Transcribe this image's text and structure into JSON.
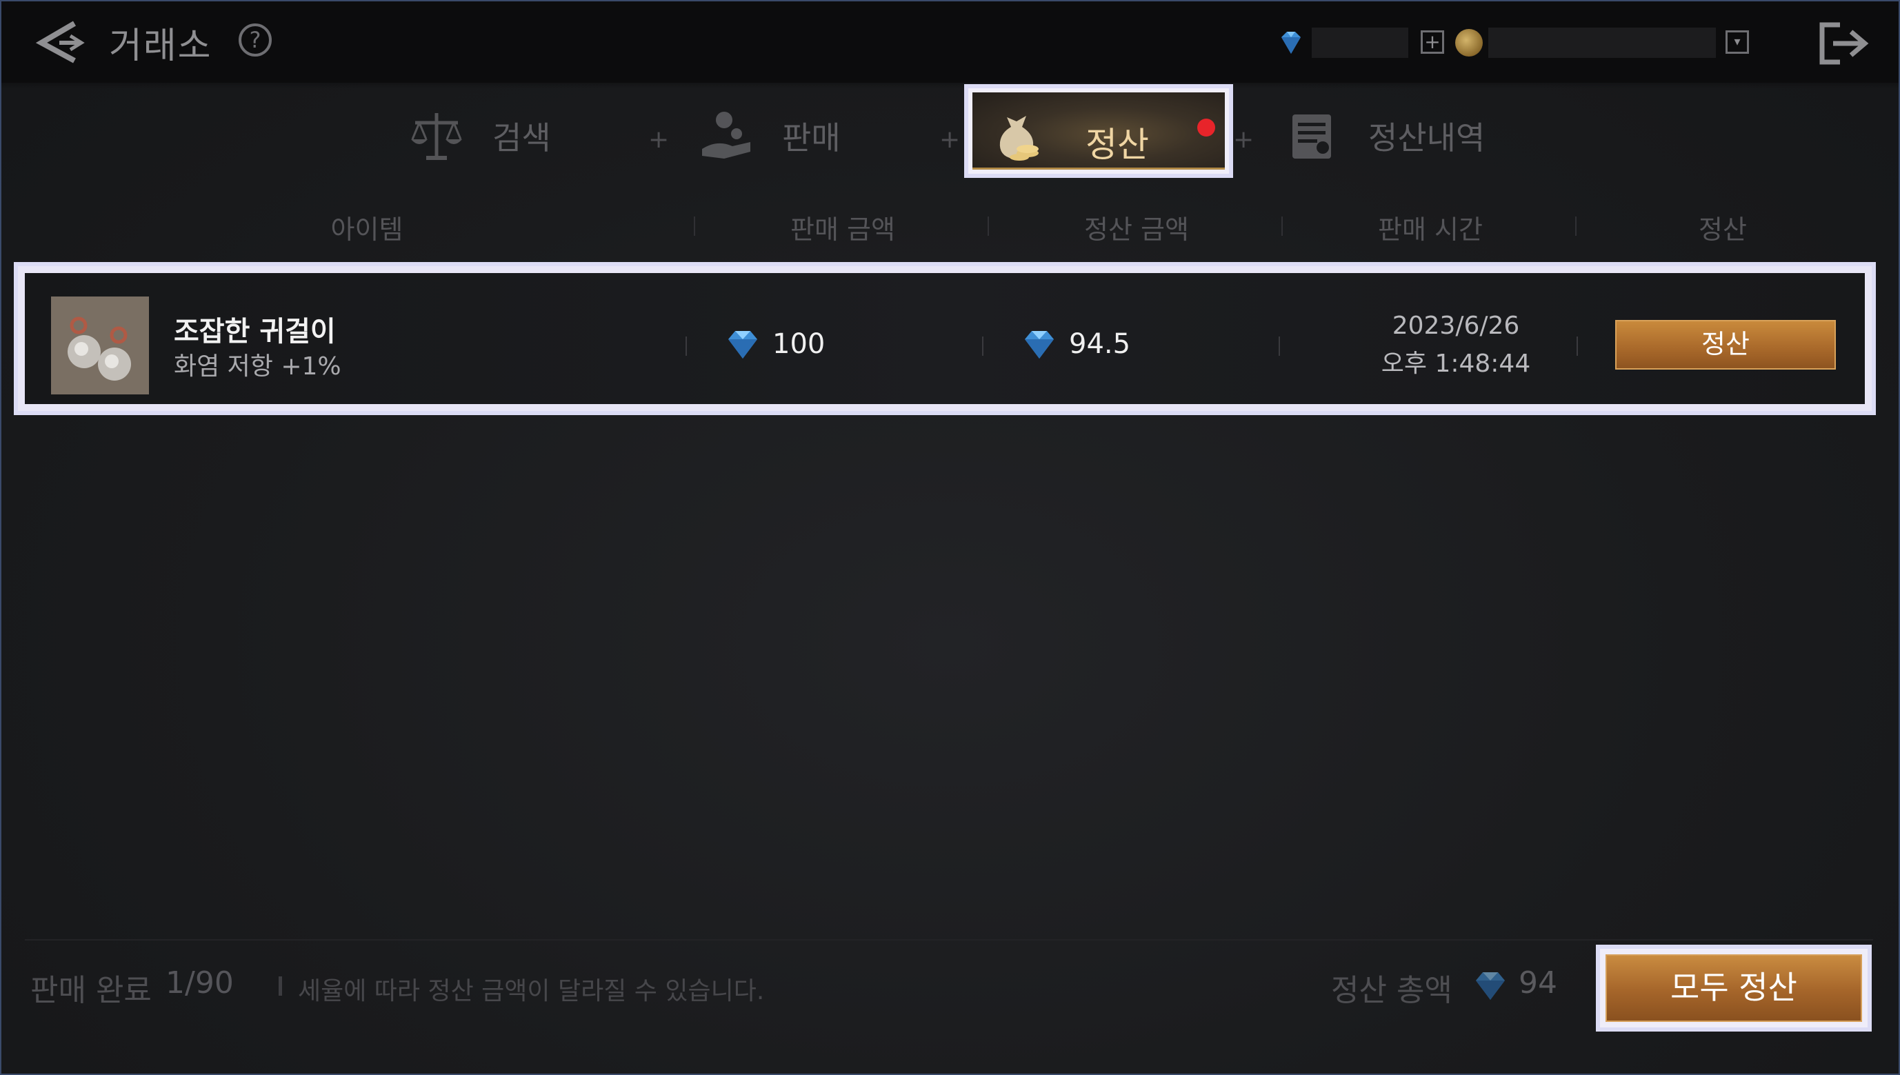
{
  "header": {
    "title": "거래소",
    "help_label": "?",
    "plus_label": "+",
    "dropdown_label": "▾"
  },
  "tabs": [
    {
      "label": "검색",
      "icon": "scales-icon",
      "active": false
    },
    {
      "label": "판매",
      "icon": "hand-coin-icon",
      "active": false
    },
    {
      "label": "정산",
      "icon": "money-bag-icon",
      "active": true,
      "has_notification": true
    },
    {
      "label": "정산내역",
      "icon": "ledger-icon",
      "active": false
    }
  ],
  "tab_separator": "+",
  "columns": [
    "아이템",
    "판매 금액",
    "정산 금액",
    "판매 시간",
    "정산"
  ],
  "rows": [
    {
      "item_name": "조잡한 귀걸이",
      "item_effect": "화염 저항 +1%",
      "sale_amount": "100",
      "settle_amount": "94.5",
      "sale_date": "2023/6/26",
      "sale_time": "오후 1:48:44",
      "button_label": "정산"
    }
  ],
  "footer": {
    "sold_label": "판매 완료",
    "sold_value": "1/90",
    "note": "세율에 따라 정산 금액이 달라질 수 있습니다.",
    "total_label": "정산 총액",
    "total_value": "94",
    "settle_all_label": "모두 정산"
  },
  "colors": {
    "accent_button": "#b3732f",
    "highlight_frame": "#dcdcf5",
    "notification": "#e8242a",
    "active_tab_text": "#f0d6a4"
  }
}
